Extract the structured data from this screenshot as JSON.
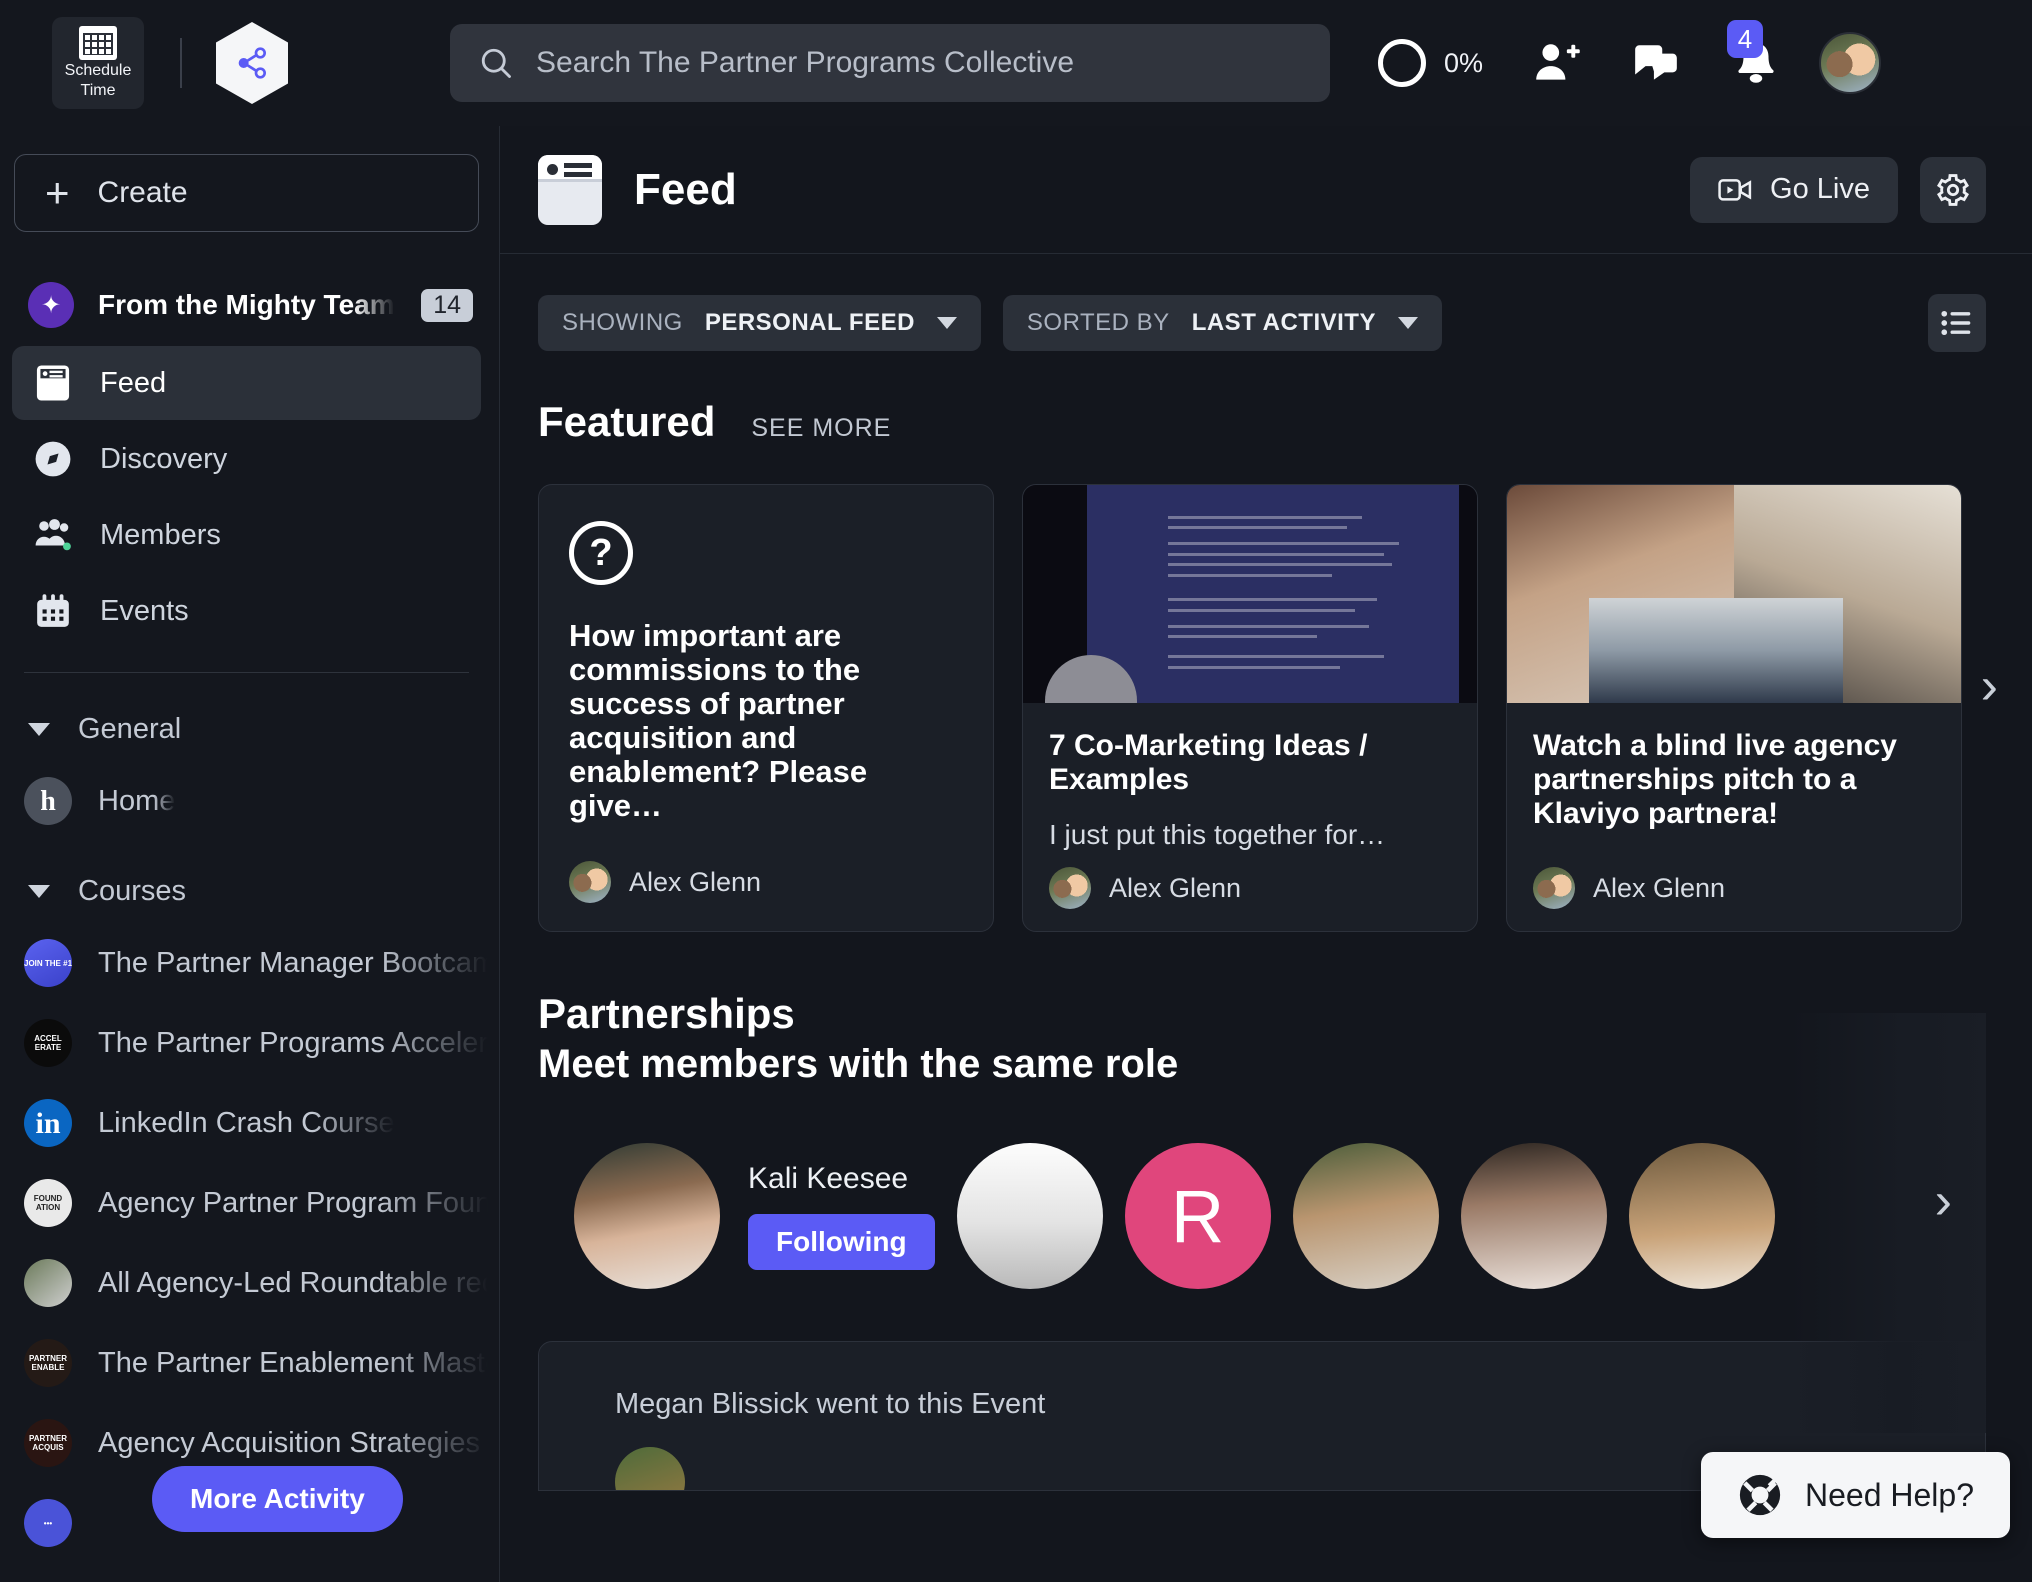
{
  "topbar": {
    "schedule_tile": {
      "line1": "Schedule",
      "line2": "Time",
      "icon": "calendar-icon"
    },
    "logo_icon": "share-nodes-logo",
    "search": {
      "placeholder": "Search The Partner Programs Collective",
      "value": "",
      "icon": "search-icon"
    },
    "progress": {
      "percent_label": "0%",
      "value": 0
    },
    "icons": [
      {
        "name": "add-person-icon"
      },
      {
        "name": "messages-icon"
      },
      {
        "name": "notifications-bell-icon",
        "badge": "4"
      }
    ],
    "avatar": {
      "name": "user-avatar"
    }
  },
  "sidebar": {
    "create_label": "Create",
    "mighty": {
      "label": "From the Mighty Team",
      "count": "14"
    },
    "nav": [
      {
        "label": "Feed",
        "icon": "feed-icon",
        "active": true
      },
      {
        "label": "Discovery",
        "icon": "compass-icon",
        "active": false
      },
      {
        "label": "Members",
        "icon": "members-icon",
        "active": false
      },
      {
        "label": "Events",
        "icon": "calendar-events-icon",
        "active": false
      }
    ],
    "groups": [
      {
        "label": "General",
        "items": [
          {
            "label": "Home",
            "avatar_letter": "h"
          }
        ]
      },
      {
        "label": "Courses",
        "items": [
          {
            "label": "The Partner Manager Bootcamp"
          },
          {
            "label": "The Partner Programs Accelerator"
          },
          {
            "label": "LinkedIn Crash Course"
          },
          {
            "label": "Agency Partner Program Foundations"
          },
          {
            "label": "All Agency-Led Roundtable recordings"
          },
          {
            "label": "The Partner Enablement Masterclass"
          },
          {
            "label": "Agency Acquisition Strategies Strategy"
          }
        ]
      }
    ],
    "more_activity_label": "More Activity"
  },
  "main": {
    "header": {
      "title": "Feed",
      "icon": "feed-icon",
      "go_live_label": "Go Live",
      "go_live_icon": "video-camera-icon",
      "settings_icon": "gear-icon"
    },
    "filters": [
      {
        "prefix": "SHOWING",
        "value": "PERSONAL FEED",
        "icon": "chevron-down-icon"
      },
      {
        "prefix": "SORTED BY",
        "value": "LAST ACTIVITY",
        "icon": "chevron-down-icon"
      }
    ],
    "list_view_icon": "list-view-icon",
    "featured": {
      "title": "Featured",
      "see_more_label": "SEE MORE",
      "next_icon": "chevron-right-icon",
      "cards": [
        {
          "kind": "question",
          "icon": "question-mark-icon",
          "title": "How important are commissions to the success of partner acquisition and enablement? Please give…",
          "subtitle": "",
          "author": "Alex Glenn"
        },
        {
          "kind": "media-doc",
          "title": "7 Co-Marketing Ideas / Examples",
          "subtitle": "I just put this together for…",
          "author": "Alex Glenn"
        },
        {
          "kind": "media-video",
          "title": "Watch a blind live agency partnerships pitch to a Klaviyo partnera!",
          "subtitle": "",
          "author": "Alex Glenn"
        }
      ]
    },
    "partnerships": {
      "title": "Partnerships",
      "subtitle": "Meet members with the same role",
      "next_icon": "chevron-right-icon",
      "people": [
        {
          "name": "Kali Keesee",
          "action_label": "Following",
          "avatar": "photo"
        },
        {
          "name": "",
          "avatar": "photo"
        },
        {
          "name": "",
          "avatar": "initial",
          "initial": "R"
        },
        {
          "name": "",
          "avatar": "photo"
        },
        {
          "name": "",
          "avatar": "photo"
        },
        {
          "name": "",
          "avatar": "photo"
        }
      ]
    },
    "post": {
      "activity_line": "Megan Blissick went to this Event"
    },
    "need_help": {
      "label": "Need Help?",
      "icon": "life-ring-icon"
    }
  },
  "colors": {
    "accent": "#5b5bf5",
    "bg": "#13161d",
    "panel": "#1b1f27",
    "pink": "#e0467c"
  }
}
